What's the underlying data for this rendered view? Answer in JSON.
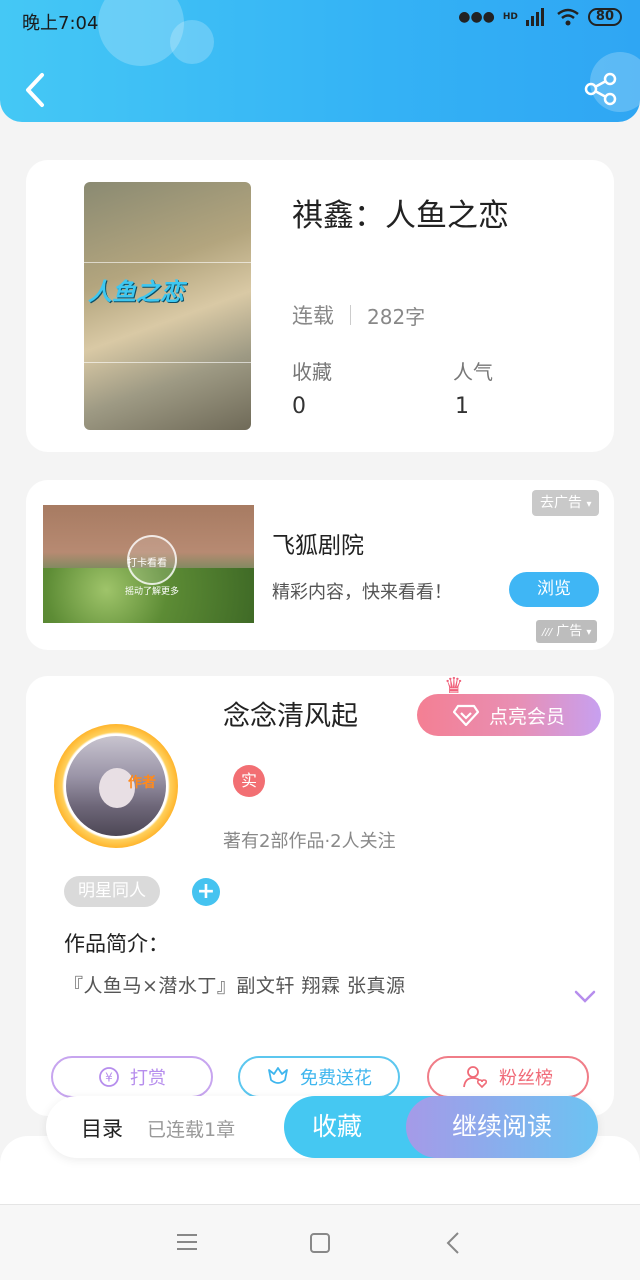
{
  "status_bar": {
    "time": "晚上7:04",
    "network": "HD",
    "battery": "80"
  },
  "header": {
    "back_icon": "chevron-left-icon",
    "share_icon": "share-icon"
  },
  "book": {
    "cover_title": "人鱼之恋",
    "title": "祺鑫：人鱼之恋",
    "status": "连载",
    "word_count": "282字",
    "favorites_label": "收藏",
    "favorites_value": "0",
    "popularity_label": "人气",
    "popularity_value": "1"
  },
  "ad": {
    "image_text_1": "打卡看看",
    "image_text_2": "摇动了解更多",
    "title": "飞狐剧院",
    "description": "精彩内容，快来看看！",
    "browse_label": "浏览",
    "remove_ad_label": "去广告",
    "ad_tag_label": "广告"
  },
  "author": {
    "badge": "作者",
    "name": "念念清风起",
    "vip_label": "点亮会员",
    "real_badge": "实",
    "stats": "著有2部作品·2人关注",
    "tag": "明星同人",
    "intro_label": "作品简介：",
    "intro_text": "『人鱼马×潜水丁』副文轩 翔霖 张真源"
  },
  "actions": {
    "tip_label": "打赏",
    "flower_label": "免费送花",
    "fans_label": "粉丝榜"
  },
  "bottom_bar": {
    "toc_label": "目录",
    "toc_count": "已连载1章",
    "collect_label": "收藏",
    "read_label": "继续阅读"
  },
  "colors": {
    "primary": "#3fb6f5",
    "vip_start": "#f47f93",
    "vip_end": "#c7a0f0",
    "tip": "#b68ded",
    "fans": "#f06b78"
  }
}
